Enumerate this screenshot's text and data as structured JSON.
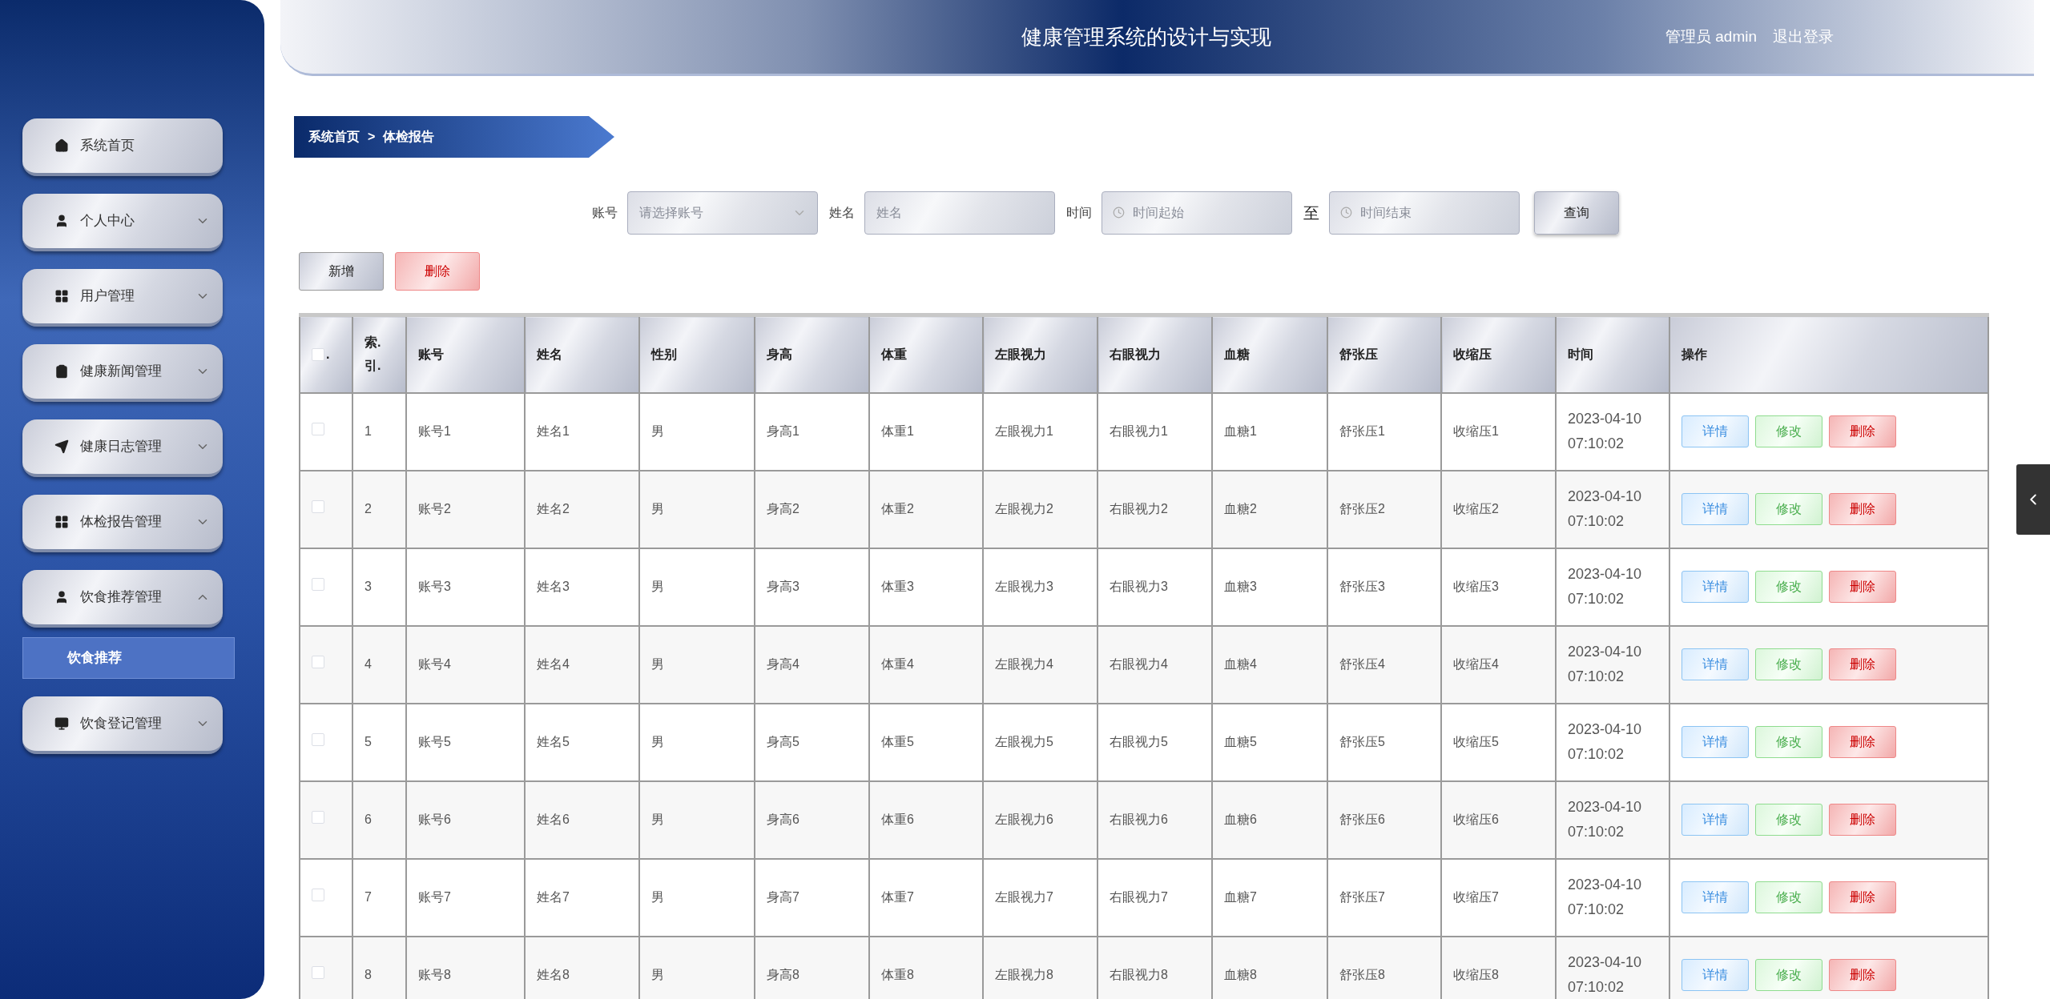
{
  "header": {
    "title": "健康管理系统的设计与实现",
    "user_role": "管理员",
    "user_name": "admin",
    "logout": "退出登录"
  },
  "sidebar": {
    "items": [
      {
        "kind": "link",
        "label": "系统首页"
      },
      {
        "kind": "menu",
        "label": "个人中心",
        "expanded": false
      },
      {
        "kind": "menu",
        "label": "用户管理",
        "expanded": false
      },
      {
        "kind": "menu",
        "label": "健康新闻管理",
        "expanded": false
      },
      {
        "kind": "menu",
        "label": "健康日志管理",
        "expanded": false
      },
      {
        "kind": "menu",
        "label": "体检报告管理",
        "expanded": false
      },
      {
        "kind": "menu",
        "label": "饮食推荐管理",
        "expanded": true,
        "children": [
          {
            "label": "饮食推荐",
            "selected": true
          }
        ]
      },
      {
        "kind": "menu",
        "label": "饮食登记管理",
        "expanded": false
      }
    ]
  },
  "breadcrumb": {
    "items": [
      "系统首页",
      "体检报告"
    ],
    "separator": ">"
  },
  "search": {
    "fields": [
      {
        "kind": "select",
        "label": "账号",
        "placeholder": "请选择账号"
      },
      {
        "kind": "text",
        "label": "姓名",
        "placeholder": "姓名"
      },
      {
        "kind": "date",
        "label": "时间",
        "placeholder": "时间起始"
      },
      {
        "kind": "date",
        "label": "至",
        "placeholder": "时间结束"
      }
    ],
    "button": "查询"
  },
  "actions": [
    {
      "kind": "add",
      "label": "新增"
    },
    {
      "kind": "delete",
      "label": "删除"
    }
  ],
  "table": {
    "select_all": false,
    "select_header": ".",
    "columns": [
      "索.引.",
      "账号",
      "姓名",
      "性别",
      "身高",
      "体重",
      "左眼视力",
      "右眼视力",
      "血糖",
      "舒张压",
      "收缩压",
      "时间",
      "操作"
    ],
    "rows": [
      {
        "checked": false,
        "cells": [
          "1",
          "账号1",
          "姓名1",
          "男",
          "身高1",
          "体重1",
          "左眼视力1",
          "右眼视力1",
          "血糖1",
          "舒张压1",
          "收缩压1",
          "2023-04-10 07:10:02"
        ],
        "actions": [
          {
            "kind": "detail",
            "label": "详情"
          },
          {
            "kind": "edit",
            "label": "修改"
          },
          {
            "kind": "delete",
            "label": "删除"
          }
        ]
      },
      {
        "checked": false,
        "cells": [
          "2",
          "账号2",
          "姓名2",
          "男",
          "身高2",
          "体重2",
          "左眼视力2",
          "右眼视力2",
          "血糖2",
          "舒张压2",
          "收缩压2",
          "2023-04-10 07:10:02"
        ],
        "actions": [
          {
            "kind": "detail",
            "label": "详情"
          },
          {
            "kind": "edit",
            "label": "修改"
          },
          {
            "kind": "delete",
            "label": "删除"
          }
        ]
      },
      {
        "checked": false,
        "cells": [
          "3",
          "账号3",
          "姓名3",
          "男",
          "身高3",
          "体重3",
          "左眼视力3",
          "右眼视力3",
          "血糖3",
          "舒张压3",
          "收缩压3",
          "2023-04-10 07:10:02"
        ],
        "actions": [
          {
            "kind": "detail",
            "label": "详情"
          },
          {
            "kind": "edit",
            "label": "修改"
          },
          {
            "kind": "delete",
            "label": "删除"
          }
        ]
      },
      {
        "checked": false,
        "cells": [
          "4",
          "账号4",
          "姓名4",
          "男",
          "身高4",
          "体重4",
          "左眼视力4",
          "右眼视力4",
          "血糖4",
          "舒张压4",
          "收缩压4",
          "2023-04-10 07:10:02"
        ],
        "actions": [
          {
            "kind": "detail",
            "label": "详情"
          },
          {
            "kind": "edit",
            "label": "修改"
          },
          {
            "kind": "delete",
            "label": "删除"
          }
        ]
      },
      {
        "checked": false,
        "cells": [
          "5",
          "账号5",
          "姓名5",
          "男",
          "身高5",
          "体重5",
          "左眼视力5",
          "右眼视力5",
          "血糖5",
          "舒张压5",
          "收缩压5",
          "2023-04-10 07:10:02"
        ],
        "actions": [
          {
            "kind": "detail",
            "label": "详情"
          },
          {
            "kind": "edit",
            "label": "修改"
          },
          {
            "kind": "delete",
            "label": "删除"
          }
        ]
      },
      {
        "checked": false,
        "cells": [
          "6",
          "账号6",
          "姓名6",
          "男",
          "身高6",
          "体重6",
          "左眼视力6",
          "右眼视力6",
          "血糖6",
          "舒张压6",
          "收缩压6",
          "2023-04-10 07:10:02"
        ],
        "actions": [
          {
            "kind": "detail",
            "label": "详情"
          },
          {
            "kind": "edit",
            "label": "修改"
          },
          {
            "kind": "delete",
            "label": "删除"
          }
        ]
      },
      {
        "checked": false,
        "cells": [
          "7",
          "账号7",
          "姓名7",
          "男",
          "身高7",
          "体重7",
          "左眼视力7",
          "右眼视力7",
          "血糖7",
          "舒张压7",
          "收缩压7",
          "2023-04-10 07:10:02"
        ],
        "actions": [
          {
            "kind": "detail",
            "label": "详情"
          },
          {
            "kind": "edit",
            "label": "修改"
          },
          {
            "kind": "delete",
            "label": "删除"
          }
        ]
      },
      {
        "checked": false,
        "cells": [
          "8",
          "账号8",
          "姓名8",
          "男",
          "身高8",
          "体重8",
          "左眼视力8",
          "右眼视力8",
          "血糖8",
          "舒张压8",
          "收缩压8",
          "2023-04-10 07:10:02"
        ],
        "actions": [
          {
            "kind": "detail",
            "label": "详情"
          },
          {
            "kind": "edit",
            "label": "修改"
          },
          {
            "kind": "delete",
            "label": "删除"
          }
        ]
      }
    ]
  }
}
